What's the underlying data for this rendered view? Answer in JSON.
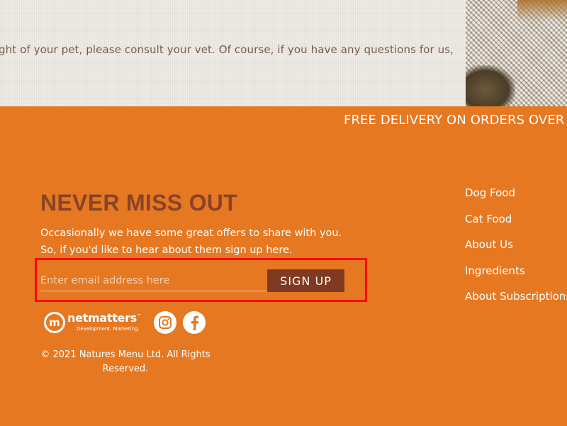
{
  "top_band": {
    "text": "ght of your pet, please consult your vet. Of course, if you have any questions for us,"
  },
  "ticker": {
    "text": "FREE DELIVERY ON ORDERS OVER £"
  },
  "newsletter": {
    "title": "NEVER MISS OUT",
    "line1": "Occasionally we have some great offers to share with you.",
    "line2": "So, if you'd like to hear about them sign up here.",
    "email_placeholder": "Enter email address here",
    "email_value": "",
    "signup_label": "SIGN UP"
  },
  "logos": {
    "netmatters_letter": "m",
    "netmatters_name": "netmatters",
    "netmatters_tagline": "Development. Marketing.",
    "netmatters_tm": "™"
  },
  "social": [
    {
      "icon": "instagram-icon"
    },
    {
      "icon": "facebook-icon"
    }
  ],
  "copyright": "© 2021 Natures Menu Ltd. All Rights Reserved.",
  "footer_nav": {
    "items": [
      {
        "label": "Dog Food"
      },
      {
        "label": "Cat Food"
      },
      {
        "label": "About Us"
      },
      {
        "label": "Ingredients"
      },
      {
        "label": "About Subscriptions"
      }
    ]
  },
  "colors": {
    "background": "#e67822",
    "title": "#8a4326",
    "button": "#7f3a1f",
    "highlight": "#ff0000"
  }
}
